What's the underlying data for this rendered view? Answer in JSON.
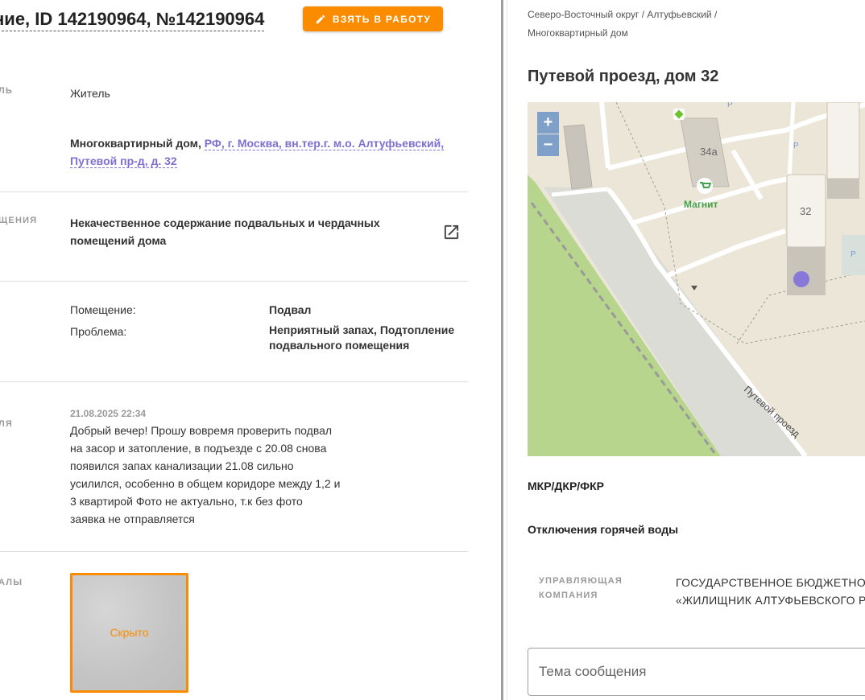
{
  "header": {
    "title": "ние, ID 142190964, №142190964",
    "take_button": "ВЗЯТЬ В РАБОТУ"
  },
  "sections": {
    "applicant": {
      "label": "ЛЬ",
      "value": "Житель"
    },
    "address": {
      "prefix": "Многоквартирный дом, ",
      "link_line1": "РФ, г. Москва, вн.тер.г. м.о. Алтуфьевский,",
      "link_line2": "Путевой пр-д, д. 32"
    },
    "category": {
      "label": "ЩЕНИЯ",
      "line1": "Некачественное содержание подвальных и чердачных",
      "line2": "помещений дома"
    },
    "details": {
      "room_label": "Помещение:",
      "room_value": "Подвал",
      "problem_label": "Проблема:",
      "problem_line1": "Неприятный запах, Подтопление",
      "problem_line2": "подвального помещения"
    },
    "message": {
      "label": "ЛЯ",
      "timestamp": "21.08.2025 22:34",
      "lines": [
        "Добрый вечер! Прошу вовремя проверить подвал",
        "на засор и затопление, в подъезде с 20.08 снова",
        "появился запах канализации 21.08 сильно",
        "усилился, особенно в общем коридоре между 1,2 и",
        "3 квартирой Фото не актуально, т.к без фото",
        "заявка не отправляется"
      ]
    },
    "photos": {
      "label": "АЛЫ",
      "hidden_text": "Скрыто"
    }
  },
  "right_panel": {
    "breadcrumb_line1": "Северо-Восточный округ / Алтуфьевский /",
    "breadcrumb_line2": "Многоквартирный дом",
    "address_title": "Путевой проезд, дом 32",
    "map": {
      "zoom_in": "+",
      "zoom_out": "−",
      "label_34a": "34а",
      "label_32": "32",
      "label_magnit": "Магнит",
      "street": "Путевой проезд",
      "parking": "P"
    },
    "program": "МКР/ДКР/ФКР",
    "hot_water": "Отключения горячей воды",
    "mc_label_line1": "УПРАВЛЯЮЩАЯ",
    "mc_label_line2": "КОМПАНИЯ",
    "mc_value_line1": "ГОСУДАРСТВЕННОЕ БЮДЖЕТНОЕ",
    "mc_value_line2": "«ЖИЛИЩНИК АЛТУФЬЕВСКОГО Р",
    "topic_placeholder": "Тема сообщения"
  },
  "colors": {
    "accent_orange": "#fb8c00",
    "link_purple": "#7e6fd0",
    "map_marker": "#8a78d8"
  }
}
